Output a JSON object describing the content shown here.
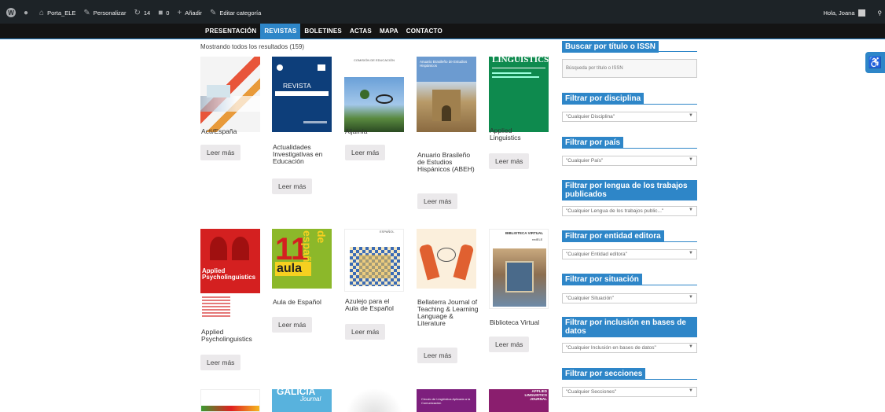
{
  "adminbar": {
    "site": "Porta_ELE",
    "customize": "Personalizar",
    "updates": "14",
    "comments": "0",
    "add_new": "Añadir",
    "edit_category": "Editar categoría",
    "greeting": "Hola, Joana"
  },
  "nav": {
    "items": [
      "PRESENTACIÓN",
      "REVISTAS",
      "BOLETINES",
      "ACTAS",
      "MAPA",
      "CONTACTO"
    ]
  },
  "results": {
    "count_text": "Mostrando todos los resultados (159)",
    "button_label": "Leer más",
    "products": [
      {
        "title": "Acti/España"
      },
      {
        "title": "Actualidades Investigativas en Educación"
      },
      {
        "title": "Aljamía"
      },
      {
        "title": "Anuario Brasileño de Estudios Hispánicos (ABEH)"
      },
      {
        "title": "Applied Linguistics"
      },
      {
        "title": "Applied Psycholinguistics"
      },
      {
        "title": "Aula de Español"
      },
      {
        "title": "Azulejo para el Aula de Español"
      },
      {
        "title": "Bellaterra Journal of Teaching & Learning Language & Literature"
      },
      {
        "title": "Biblioteca Virtual"
      }
    ],
    "cover_text": {
      "revista": "REVISTA",
      "comision": "COMISIÓN DE EDUCACIÓN",
      "linguistics": "LINGUISTICS",
      "anuario": "Anuario Brasileño de Estudios Hispánicos",
      "applied": "Applied Psycholinguistics",
      "aula_num": "11",
      "aula": "aula",
      "aula_esp": "de español",
      "espanol": "ESPAÑOL",
      "bib": "BIBLIOTECA VIRTUAL",
      "redele": "redELE",
      "galicia": "GALICIA",
      "journal": "Journal",
      "circulo": "Círculo de Lingüística Aplicada a la Comunicación",
      "alj": "APPLIED LINGUISTICS JOURNAL"
    }
  },
  "sidebar": {
    "search_title": "Buscar por título o ISSN",
    "search_placeholder": "Búsqueda por título o ISSN",
    "filters": [
      {
        "title": "Filtrar por disciplina",
        "value": "\"Cualquier Disciplina\""
      },
      {
        "title": "Filtrar por país",
        "value": "\"Cualquier País\""
      },
      {
        "title": "Filtrar por lengua de los trabajos publicados",
        "value": "\"Cualquier Lengua de los trabajos public...\""
      },
      {
        "title": "Filtrar por entidad editora",
        "value": "\"Cualquier Entidad editora\""
      },
      {
        "title": "Filtrar por situación",
        "value": "\"Cualquier Situación\""
      },
      {
        "title": "Filtrar por inclusión en bases de datos",
        "value": "\"Cualquier Inclusión en bases de datos\""
      },
      {
        "title": "Filtrar por secciones",
        "value": "\"Cualquier Secciones\""
      }
    ]
  },
  "colors": {
    "accent": "#2e86c8",
    "adminbar": "#1d2327",
    "nav": "#141414"
  }
}
